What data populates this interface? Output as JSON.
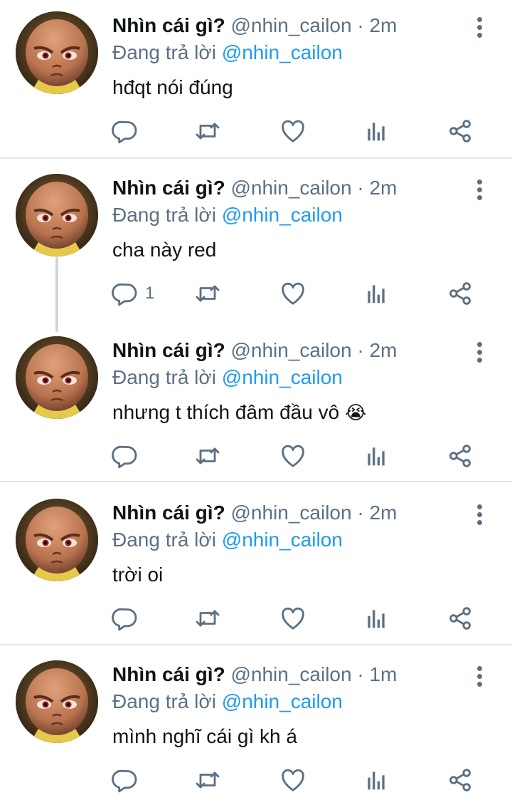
{
  "tweets": [
    {
      "name": "Nhìn cái gì?",
      "handle": "@nhin_cailon",
      "separator": "·",
      "time": "2m",
      "reply_prefix": "Đang trả lời",
      "reply_to": "@nhin_cailon",
      "text": "hđqt nói đúng",
      "emoji": "",
      "reply_count": ""
    },
    {
      "name": "Nhìn cái gì?",
      "handle": "@nhin_cailon",
      "separator": "·",
      "time": "2m",
      "reply_prefix": "Đang trả lời",
      "reply_to": "@nhin_cailon",
      "text": "cha này red",
      "emoji": "",
      "reply_count": "1"
    },
    {
      "name": "Nhìn cái gì?",
      "handle": "@nhin_cailon",
      "separator": "·",
      "time": "2m",
      "reply_prefix": "Đang trả lời",
      "reply_to": "@nhin_cailon",
      "text": "nhưng t thích đâm đầu vô ",
      "emoji": "😭",
      "reply_count": ""
    },
    {
      "name": "Nhìn cái gì?",
      "handle": "@nhin_cailon",
      "separator": "·",
      "time": "2m",
      "reply_prefix": "Đang trả lời",
      "reply_to": "@nhin_cailon",
      "text": "trời oi",
      "emoji": "",
      "reply_count": ""
    },
    {
      "name": "Nhìn cái gì?",
      "handle": "@nhin_cailon",
      "separator": "·",
      "time": "1m",
      "reply_prefix": "Đang trả lời",
      "reply_to": "@nhin_cailon",
      "text": "mình nghĩ cái gì kh á",
      "emoji": "",
      "reply_count": ""
    }
  ],
  "icons": {
    "more": "more-vertical-icon",
    "reply": "comment-bubble-icon",
    "retweet": "retweet-icon",
    "like": "heart-icon",
    "analytics": "bar-chart-icon",
    "share": "share-icon"
  },
  "colors": {
    "text_primary": "#0f1419",
    "text_secondary": "#5b7083",
    "mention": "#1d9bf0",
    "divider": "#e3e6e8",
    "thread_line": "#d0d5d9"
  }
}
